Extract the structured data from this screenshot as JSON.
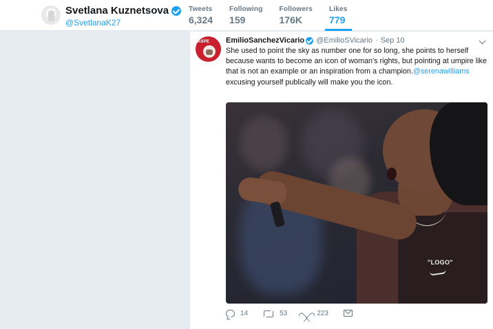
{
  "profile": {
    "display_name": "Svetlana Kuznetsova",
    "handle": "@SvetlanaK27",
    "verified": true
  },
  "stats": [
    {
      "label": "Tweets",
      "value": "6,324",
      "active": false
    },
    {
      "label": "Following",
      "value": "159",
      "active": false
    },
    {
      "label": "Followers",
      "value": "176K",
      "active": false
    },
    {
      "label": "Likes",
      "value": "779",
      "active": true
    }
  ],
  "tweet": {
    "author_name": "EmilioSanchezVicario",
    "author_handle": "@EmilioSVicario",
    "separator": "·",
    "timestamp": "Sep 10",
    "avatar_brand": "ASPE",
    "text_before": "She used to point the sky as number one for so long, she points to herself because wants to become an icon of woman's rights, but pointing at umpire like that is not an example or an inspiration from a champion.",
    "mention": "@serenawilliams",
    "text_after": "  excusing yourself publically will make you the icon.",
    "photo_logo_text": "\"LOGO\"",
    "actions": {
      "replies": "14",
      "retweets": "53",
      "likes": "223"
    }
  },
  "colors": {
    "accent": "#1da1f2",
    "background": "#e6ecf0",
    "muted": "#657786"
  }
}
